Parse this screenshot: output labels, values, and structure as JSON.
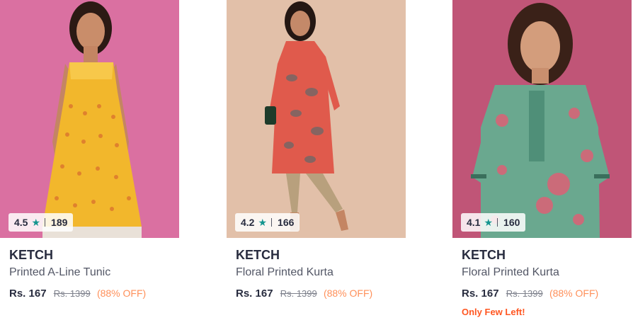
{
  "products": [
    {
      "image_desc": "yellow-printed-tunic-photo",
      "rating": "4.5",
      "rating_count": "189",
      "brand": "KETCH",
      "name": "Printed A-Line Tunic",
      "price": "Rs. 167",
      "mrp": "Rs. 1399",
      "discount": "(88% OFF)",
      "note": ""
    },
    {
      "image_desc": "red-floral-kurta-photo",
      "rating": "4.2",
      "rating_count": "166",
      "brand": "KETCH",
      "name": "Floral Printed Kurta",
      "price": "Rs. 167",
      "mrp": "Rs. 1399",
      "discount": "(88% OFF)",
      "note": ""
    },
    {
      "image_desc": "green-floral-kurta-photo",
      "rating": "4.1",
      "rating_count": "160",
      "brand": "KETCH",
      "name": "Floral Printed Kurta",
      "price": "Rs. 167",
      "mrp": "Rs. 1399",
      "discount": "(88% OFF)",
      "note": "Only Few Left!"
    }
  ],
  "icons": {
    "rating": "star-icon"
  },
  "colors": {
    "star": "#14958f",
    "discount": "#ff905a",
    "urgent": "#ff5722",
    "brand_text": "#282c3f"
  }
}
